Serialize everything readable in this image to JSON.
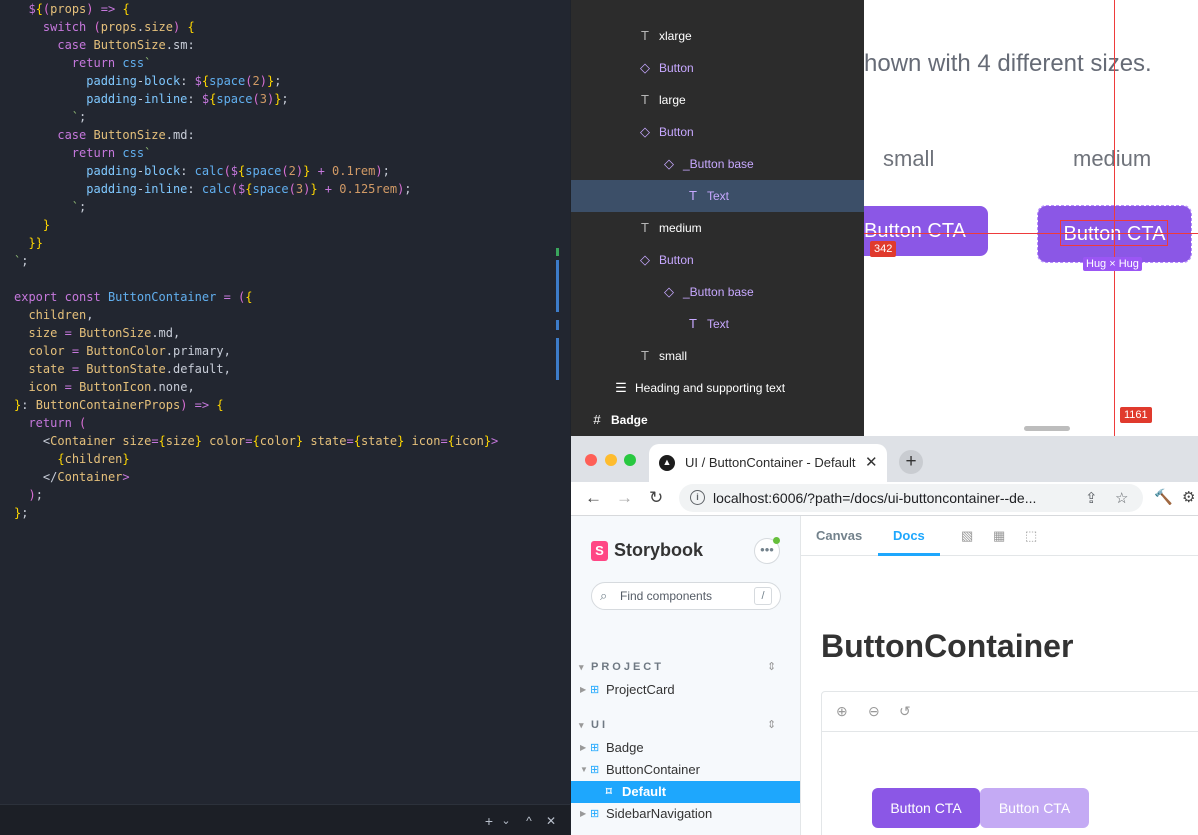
{
  "editor": {
    "code_lines": [
      "  ${(props) => {",
      "    switch (props.size) {",
      "      case ButtonSize.sm:",
      "        return css`",
      "          padding-block: ${space(2)};",
      "          padding-inline: ${space(3)};",
      "        `;",
      "      case ButtonSize.md:",
      "        return css`",
      "          padding-block: calc(${space(2)} + 0.1rem);",
      "          padding-inline: calc(${space(3)} + 0.125rem);",
      "        `;",
      "    }",
      "  }}",
      "`;",
      "",
      "export const ButtonContainer = ({",
      "  children,",
      "  size = ButtonSize.md,",
      "  color = ButtonColor.primary,",
      "  state = ButtonState.default,",
      "  icon = ButtonIcon.none,",
      "}: ButtonContainerProps) => {",
      "  return (",
      "    <Container size={size} color={color} state={state} icon={icon}>",
      "      {children}",
      "    </Container>",
      "  );",
      "};"
    ],
    "footer": {
      "add": "+",
      "chevron_down": "⌄",
      "chevron_up": "^",
      "close": "✕"
    }
  },
  "figma": {
    "layers": [
      {
        "label": "xlarge",
        "kind": "text"
      },
      {
        "label": "Button",
        "kind": "component"
      },
      {
        "label": "large",
        "kind": "text"
      },
      {
        "label": "Button",
        "kind": "component"
      },
      {
        "label": "_Button base",
        "kind": "component"
      },
      {
        "label": "Text",
        "kind": "text-component",
        "selected": true
      },
      {
        "label": "medium",
        "kind": "text"
      },
      {
        "label": "Button",
        "kind": "component"
      },
      {
        "label": "_Button base",
        "kind": "component"
      },
      {
        "label": "Text",
        "kind": "text-component"
      },
      {
        "label": "small",
        "kind": "text"
      },
      {
        "label": "Heading and supporting text",
        "kind": "textblock"
      },
      {
        "label": "Badge",
        "kind": "frame"
      }
    ],
    "canvas": {
      "heading": "hown with 4 different sizes.",
      "size_small": "small",
      "size_medium": "medium",
      "button_small": "Button CTA",
      "button_medium": "Button CTA",
      "badge_left": "342",
      "badge_bottom": "1161",
      "hug": "Hug × Hug"
    }
  },
  "browser": {
    "tab_title": "UI / ButtonContainer - Default",
    "tab_close": "✕",
    "new_tab": "+",
    "url": "localhost:6006/?path=/docs/ui-buttoncontainer--de...",
    "storybook": {
      "brand": "Storybook",
      "search_placeholder": "Find components",
      "search_shortcut": "/",
      "groups": [
        {
          "title": "PROJECT",
          "items": [
            {
              "label": "ProjectCard"
            }
          ]
        },
        {
          "title": "UI",
          "items": [
            {
              "label": "Badge"
            },
            {
              "label": "ButtonContainer"
            },
            {
              "label": "Default"
            },
            {
              "label": "SidebarNavigation"
            }
          ]
        }
      ],
      "tabs": [
        "Canvas",
        "Docs"
      ],
      "active_tab": "Docs",
      "doc_title": "ButtonContainer",
      "preview_buttons": [
        "Button CTA",
        "Button CTA"
      ]
    }
  },
  "colors": {
    "purple": "#8b57e6",
    "purple_light": "#b99af1",
    "storybook_blue": "#1ea7fd",
    "storybook_pink": "#ff4785",
    "figma_selection": "#3c4f68",
    "measure_red": "#ee3b3b"
  }
}
